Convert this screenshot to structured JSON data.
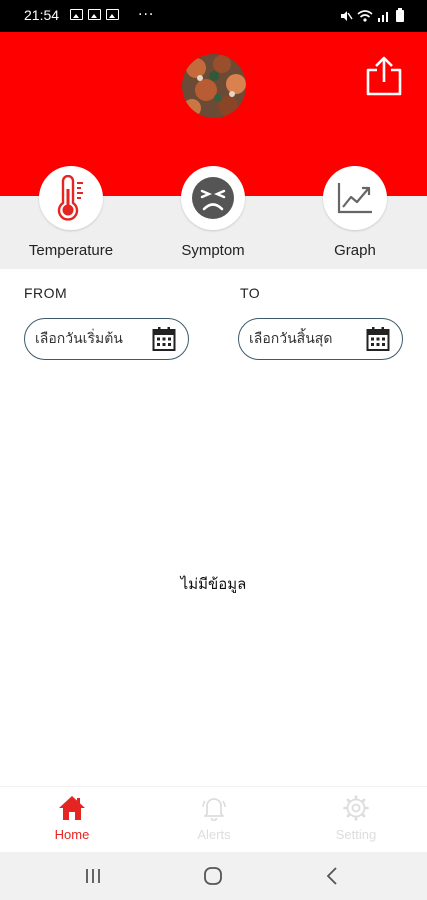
{
  "status_bar": {
    "time": "21:54",
    "overflow": "···"
  },
  "header": {
    "avatar_icon": "profile-photo",
    "share_icon": "share-icon",
    "color": "#ff0000"
  },
  "menu": [
    {
      "label": "Temperature",
      "icon": "thermometer-icon"
    },
    {
      "label": "Symptom",
      "icon": "sad-face-icon"
    },
    {
      "label": "Graph",
      "icon": "line-chart-icon"
    }
  ],
  "filters": {
    "from_label": "FROM",
    "to_label": "TO",
    "from_placeholder": "เลือกวันเริ่มต้น",
    "to_placeholder": "เลือกวันสิ้นสุด"
  },
  "empty_message": "ไม่มีข้อมูล",
  "bottom_nav": [
    {
      "label": "Home",
      "icon": "home-icon",
      "active": true
    },
    {
      "label": "Alerts",
      "icon": "bell-icon",
      "active": false
    },
    {
      "label": "Setting",
      "icon": "gear-icon",
      "active": false
    }
  ],
  "colors": {
    "accent": "#e52521",
    "inactive": "#dddddd",
    "field_border": "#3d5a6b"
  }
}
